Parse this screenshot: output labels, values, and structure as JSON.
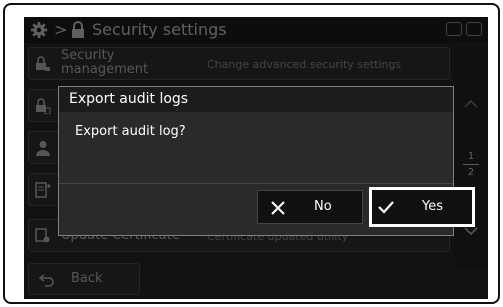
{
  "header": {
    "separator": ">",
    "title": "Security settings",
    "icons": [
      "gear-icon",
      "lock-icon",
      "sd-card-icon",
      "usb-icon"
    ]
  },
  "rows": [
    {
      "name": "Security management",
      "description": "Change advanced security settings",
      "icon": "lock-user-icon"
    },
    {
      "name": "",
      "description": "",
      "icon": "lock-doc-icon"
    },
    {
      "name": "",
      "description": "",
      "icon": "user-icon"
    },
    {
      "name": "",
      "description": "",
      "icon": "export-icon"
    },
    {
      "name": "Update Certificate",
      "description": "Certificate updated utility",
      "icon": "certificate-icon"
    }
  ],
  "pagination": {
    "current": "1",
    "total": "2"
  },
  "back": {
    "label": "Back"
  },
  "dialog": {
    "title": "Export audit logs",
    "message": "Export audit log?",
    "no_label": "No",
    "yes_label": "Yes"
  }
}
